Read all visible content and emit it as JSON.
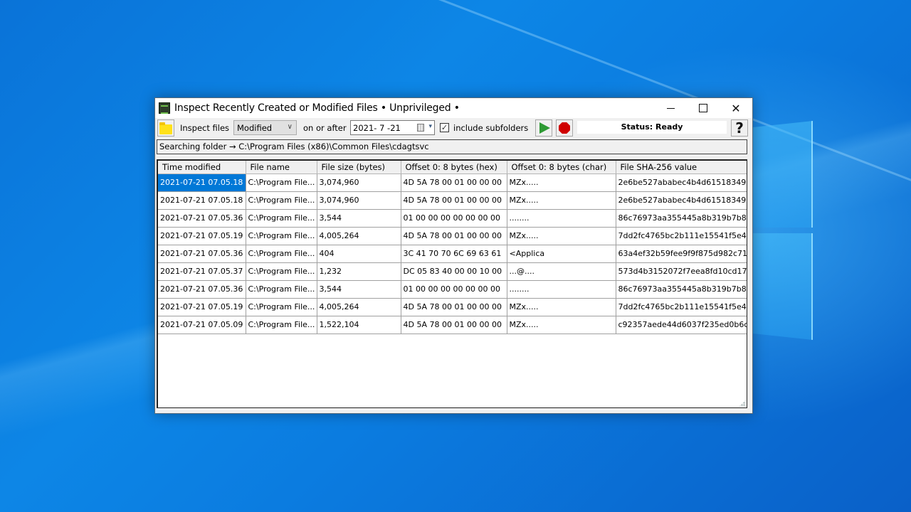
{
  "window": {
    "title": "Inspect Recently Created or Modified Files • Unprivileged •",
    "caption_buttons": {
      "minimize": "minimize",
      "maximize": "maximize",
      "close": "✕"
    }
  },
  "toolbar": {
    "folder_icon": "folder-icon",
    "inspect_label": "Inspect files",
    "mode_value": "Modified",
    "mode_chevron": "∨",
    "on_or_after_label": "on or after",
    "date_value": "2021- 7 -21",
    "date_dropdown": "▾",
    "include_subfolders_checked": true,
    "include_subfolders_check_glyph": "✓",
    "include_subfolders_label": "include subfolders",
    "run_icon": "play-icon",
    "stop_icon": "stop-icon",
    "status_text": "Status: Ready",
    "help_label": "?"
  },
  "search_path": "Searching folder → C:\\Program Files (x86)\\Common Files\\cdagtsvc",
  "table": {
    "columns": [
      "Time modified",
      "File name",
      "File size (bytes)",
      "Offset 0: 8 bytes (hex)",
      "Offset 0: 8 bytes (char)",
      "File SHA-256 value"
    ],
    "rows": [
      [
        "2021-07-21 07.05.18",
        "C:\\Program File...",
        "3,074,960",
        "4D 5A 78 00 01 00 00 00",
        "MZx.....",
        "2e6be527ababec4b4d61518349..."
      ],
      [
        "2021-07-21 07.05.18",
        "C:\\Program File...",
        "3,074,960",
        "4D 5A 78 00 01 00 00 00",
        "MZx.....",
        "2e6be527ababec4b4d61518349..."
      ],
      [
        "2021-07-21 07.05.36",
        "C:\\Program File...",
        "3,544",
        "01 00 00 00 00 00 00 00",
        "........",
        "86c76973aa355445a8b319b7b8..."
      ],
      [
        "2021-07-21 07.05.19",
        "C:\\Program File...",
        "4,005,264",
        "4D 5A 78 00 01 00 00 00",
        "MZx.....",
        "7dd2fc4765bc2b111e15541f5e4..."
      ],
      [
        "2021-07-21 07.05.36",
        "C:\\Program File...",
        "404",
        "3C 41 70 70 6C 69 63 61",
        "<Applica",
        "63a4ef32b59fee9f9f875d982c71..."
      ],
      [
        "2021-07-21 07.05.37",
        "C:\\Program File...",
        "1,232",
        "DC 05 83 40 00 00 10 00",
        "...@....",
        "573d4b3152072f7eea8fd10cd17..."
      ],
      [
        "2021-07-21 07.05.36",
        "C:\\Program File...",
        "3,544",
        "01 00 00 00 00 00 00 00",
        "........",
        "86c76973aa355445a8b319b7b8..."
      ],
      [
        "2021-07-21 07.05.19",
        "C:\\Program File...",
        "4,005,264",
        "4D 5A 78 00 01 00 00 00",
        "MZx.....",
        "7dd2fc4765bc2b111e15541f5e4..."
      ],
      [
        "2021-07-21 07.05.09",
        "C:\\Program File...",
        "1,522,104",
        "4D 5A 78 00 01 00 00 00",
        "MZx.....",
        "c92357aede44d6037f235ed0b6c..."
      ]
    ],
    "selected_row": 0,
    "selected_col": 0
  },
  "colors": {
    "selection": "#0078d7",
    "run_green": "#2e9a34",
    "stop_red": "#d00000",
    "folder_yellow": "#ffe11a"
  }
}
